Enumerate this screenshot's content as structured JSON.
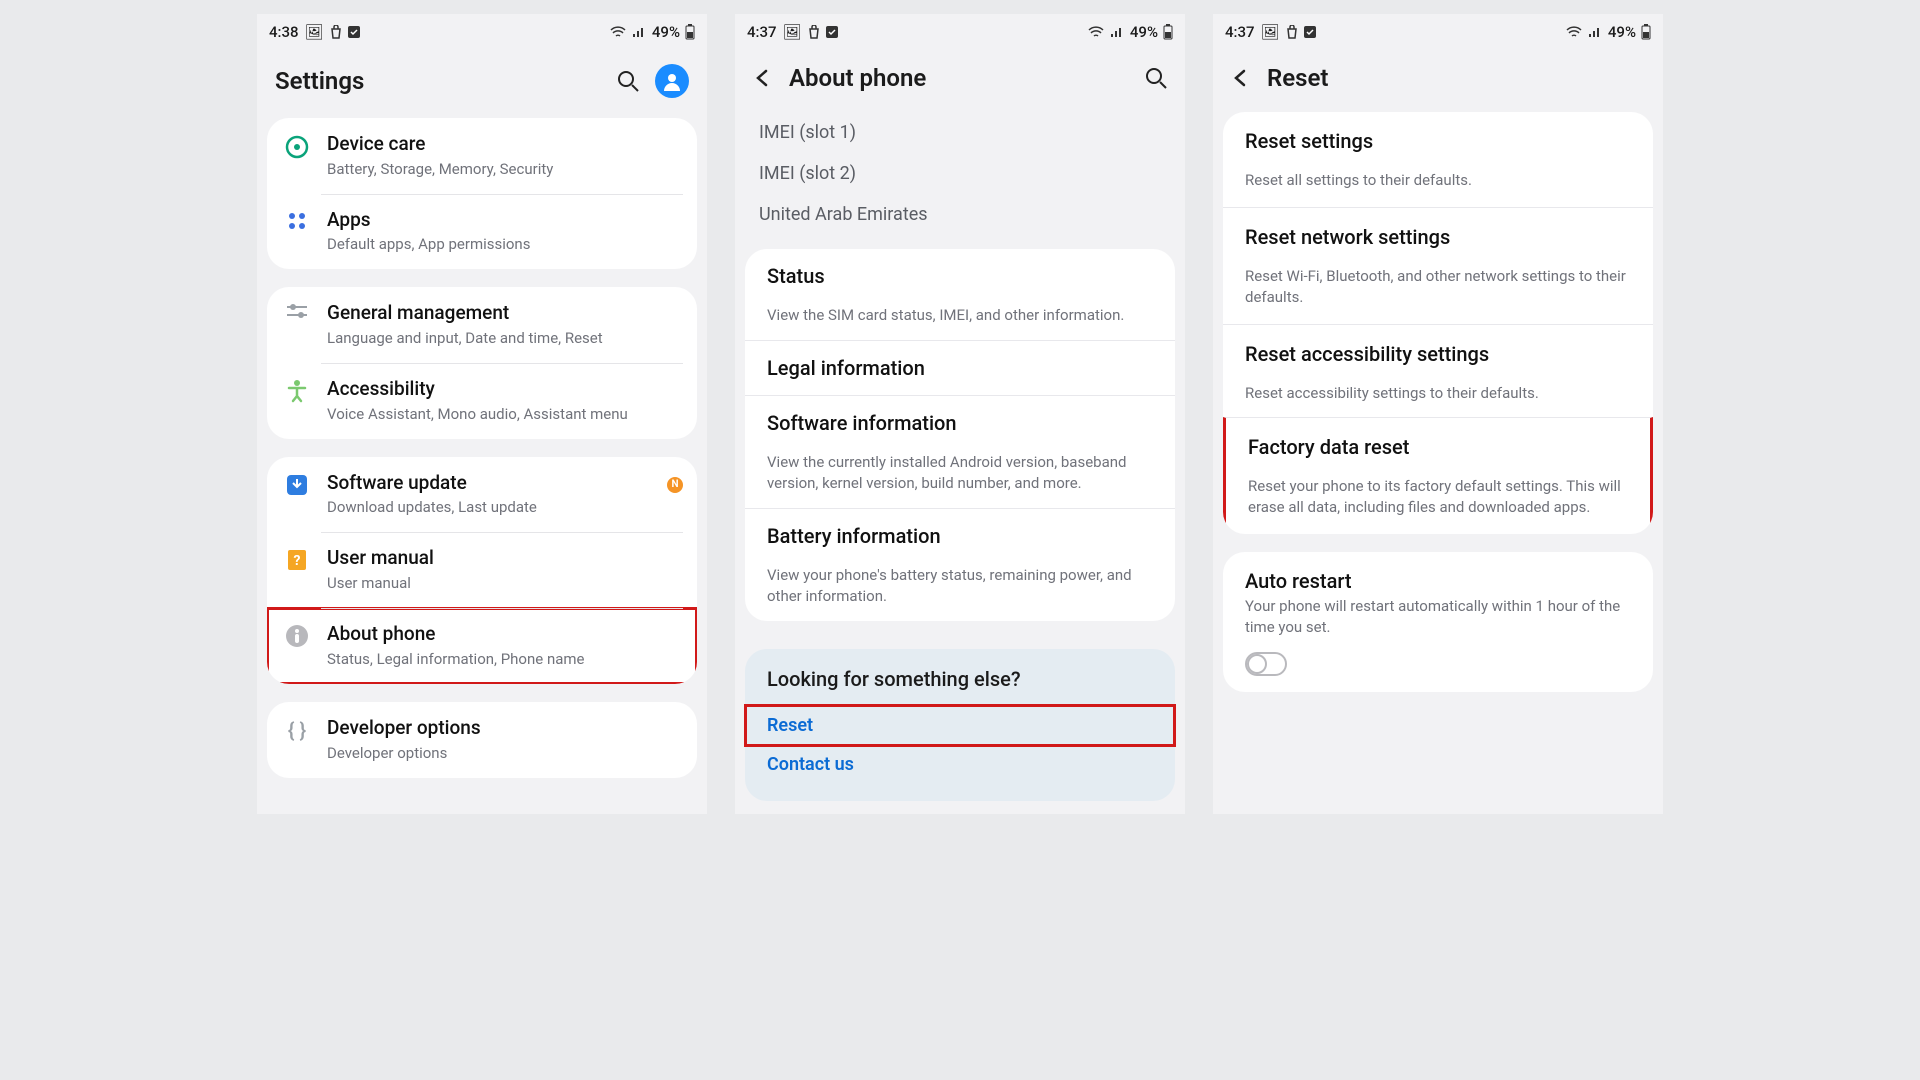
{
  "status": {
    "time_a": "4:38",
    "time_b": "4:37",
    "time_c": "4:37",
    "battery": "49%"
  },
  "screen1": {
    "title": "Settings",
    "groups": {
      "g1": [
        {
          "title": "Device care",
          "sub": "Battery, Storage, Memory, Security",
          "icon": "device"
        },
        {
          "title": "Apps",
          "sub": "Default apps, App permissions",
          "icon": "apps"
        }
      ],
      "g2": [
        {
          "title": "General management",
          "sub": "Language and input, Date and time, Reset",
          "icon": "sliders"
        },
        {
          "title": "Accessibility",
          "sub": "Voice Assistant, Mono audio, Assistant menu",
          "icon": "accessibility"
        }
      ],
      "g3": [
        {
          "title": "Software update",
          "sub": "Download updates, Last update",
          "icon": "update",
          "badge": "N"
        },
        {
          "title": "User manual",
          "sub": "User manual",
          "icon": "manual"
        },
        {
          "title": "About phone",
          "sub": "Status, Legal information, Phone name",
          "icon": "info",
          "highlight": true
        }
      ],
      "g4": [
        {
          "title": "Developer options",
          "sub": "Developer options",
          "icon": "dev"
        }
      ]
    }
  },
  "screen2": {
    "title": "About phone",
    "top_items": [
      "IMEI (slot 1)",
      "IMEI (slot 2)",
      "United Arab Emirates"
    ],
    "items": [
      {
        "title": "Status",
        "sub": "View the SIM card status, IMEI, and other information."
      },
      {
        "title": "Legal information",
        "sub": ""
      },
      {
        "title": "Software information",
        "sub": "View the currently installed Android version, baseband version, kernel version, build number, and more."
      },
      {
        "title": "Battery information",
        "sub": "View your phone's battery status, remaining power, and other information."
      }
    ],
    "suggest_title": "Looking for something else?",
    "suggest_links": [
      "Reset",
      "Contact us"
    ]
  },
  "screen3": {
    "title": "Reset",
    "items": [
      {
        "title": "Reset settings",
        "sub": "Reset all settings to their defaults."
      },
      {
        "title": "Reset network settings",
        "sub": "Reset Wi-Fi, Bluetooth, and other network settings to their defaults."
      },
      {
        "title": "Reset accessibility settings",
        "sub": "Reset accessibility settings to their defaults."
      },
      {
        "title": "Factory data reset",
        "sub": "Reset your phone to its factory default settings. This will erase all data, including files and downloaded apps.",
        "highlight": true
      }
    ],
    "auto": {
      "title": "Auto restart",
      "sub": "Your phone will restart automatically within 1 hour of the time you set."
    }
  }
}
